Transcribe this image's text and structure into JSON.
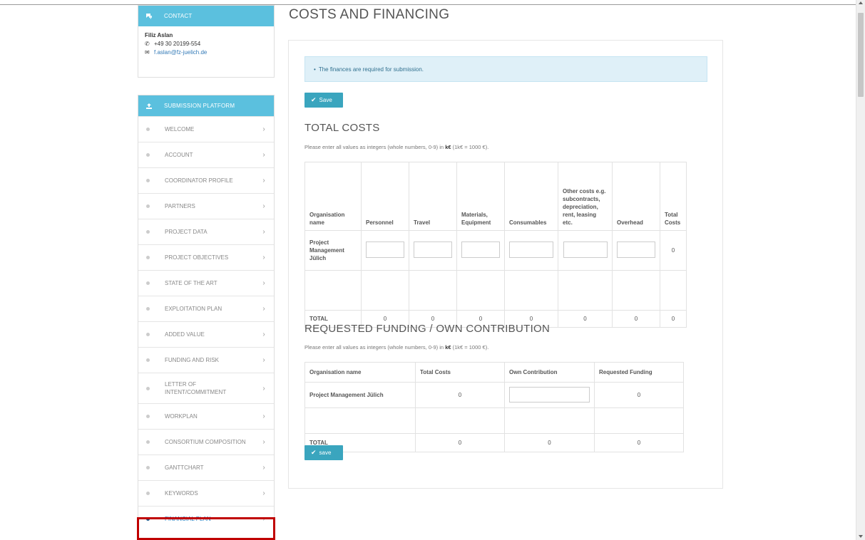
{
  "sidebar": {
    "contact": {
      "header": "CONTACT",
      "name": "Filiz Aslan",
      "phone": "+49 30 20199-554",
      "email": "f.aslan@fz-juelich.de"
    },
    "platform": {
      "header": "SUBMISSION PLATFORM",
      "items": [
        {
          "label": "WELCOME",
          "active": false
        },
        {
          "label": "ACCOUNT",
          "active": false
        },
        {
          "label": "COORDINATOR PROFILE",
          "active": false
        },
        {
          "label": "PARTNERS",
          "active": false
        },
        {
          "label": "PROJECT DATA",
          "active": false
        },
        {
          "label": "PROJECT OBJECTIVES",
          "active": false
        },
        {
          "label": "STATE OF THE ART",
          "active": false
        },
        {
          "label": "EXPLOITATION PLAN",
          "active": false
        },
        {
          "label": "ADDED VALUE",
          "active": false
        },
        {
          "label": "FUNDING AND RISK",
          "active": false
        },
        {
          "label": "LETTER OF INTENT/COMMITMENT",
          "active": false
        },
        {
          "label": "WORKPLAN",
          "active": false
        },
        {
          "label": "CONSORTIUM COMPOSITION",
          "active": false
        },
        {
          "label": "GANTTCHART",
          "active": false
        },
        {
          "label": "KEYWORDS",
          "active": false
        },
        {
          "label": "FINANCIAL PLAN",
          "active": true
        }
      ]
    }
  },
  "main": {
    "title": "COSTS AND FINANCING",
    "alert": "The finances are required for submission.",
    "save_top": "Save",
    "save_bottom": "save",
    "total_costs": {
      "heading": "TOTAL COSTS",
      "note_pre": "Please enter all values as integers (whole numbers, 0-9) in ",
      "note_unit": "k€",
      "note_post": " (1k€ = 1000 €).",
      "headers": {
        "org": "Organisation name",
        "personnel": "Personnel",
        "travel": "Travel",
        "materials": "Materials, Equipment",
        "consumables": "Consumables",
        "other": "Other costs e.g. subcontracts, depreciation, rent, leasing etc.",
        "overhead": "Overhead",
        "total": "Total Costs"
      },
      "row": {
        "org": "Project Management Jülich",
        "total": "0"
      },
      "total_row": {
        "label": "TOTAL",
        "personnel": "0",
        "travel": "0",
        "materials": "0",
        "consumables": "0",
        "other": "0",
        "overhead": "0",
        "total": "0"
      }
    },
    "funding": {
      "heading": "REQUESTED FUNDING / OWN CONTRIBUTION",
      "note_pre": "Please enter all values as integers (whole numbers, 0-9) in ",
      "note_unit": "k€",
      "note_post": " (1k€ = 1000 €).",
      "headers": {
        "org": "Organisation name",
        "total": "Total Costs",
        "own": "Own Contribution",
        "requested": "Requested Funding"
      },
      "row": {
        "org": "Project Management Jülich",
        "total": "0",
        "requested": "0"
      },
      "total_row": {
        "label": "TOTAL",
        "total": "0",
        "own": "0",
        "requested": "0"
      }
    }
  }
}
